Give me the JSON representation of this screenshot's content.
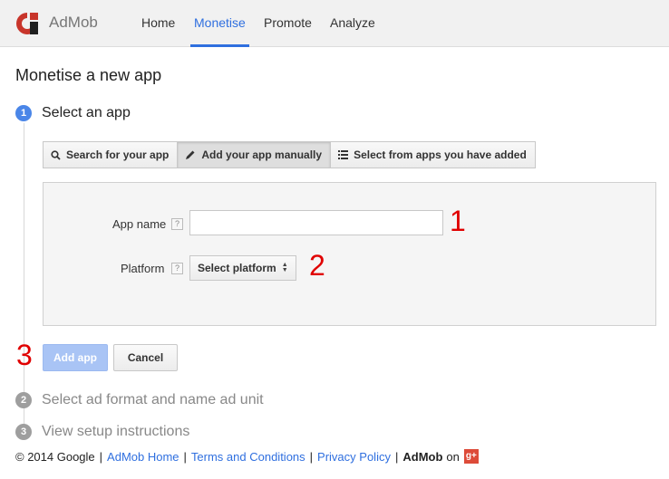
{
  "header": {
    "brand": "AdMob",
    "nav": [
      {
        "label": "Home",
        "active": false
      },
      {
        "label": "Monetise",
        "active": true
      },
      {
        "label": "Promote",
        "active": false
      },
      {
        "label": "Analyze",
        "active": false
      }
    ],
    "accent_color": "#2f6fdf",
    "logo_color": "#c8352b"
  },
  "page": {
    "title": "Monetise a new app"
  },
  "steps": [
    {
      "number": "1",
      "label": "Select an app",
      "state": "active"
    },
    {
      "number": "2",
      "label": "Select ad format and name ad unit",
      "state": "inactive"
    },
    {
      "number": "3",
      "label": "View setup instructions",
      "state": "inactive"
    }
  ],
  "tabs": [
    {
      "label": "Search for your app",
      "icon": "search-icon",
      "selected": false
    },
    {
      "label": "Add your app manually",
      "icon": "pencil-icon",
      "selected": true
    },
    {
      "label": "Select from apps you have added",
      "icon": "list-icon",
      "selected": false
    }
  ],
  "form": {
    "app_name_label": "App name",
    "app_name_value": "",
    "platform_label": "Platform",
    "platform_select": "Select platform",
    "help_glyph": "?"
  },
  "annotations": [
    "1",
    "2",
    "3"
  ],
  "annotation_color": "#e00000",
  "buttons": {
    "add": "Add app",
    "cancel": "Cancel"
  },
  "footer": {
    "copyright": "© 2014 Google",
    "links": [
      "AdMob Home",
      "Terms and Conditions",
      "Privacy Policy"
    ],
    "separator": "|",
    "admob_label": "AdMob",
    "on_label": "on",
    "gplus_label": "g+"
  }
}
